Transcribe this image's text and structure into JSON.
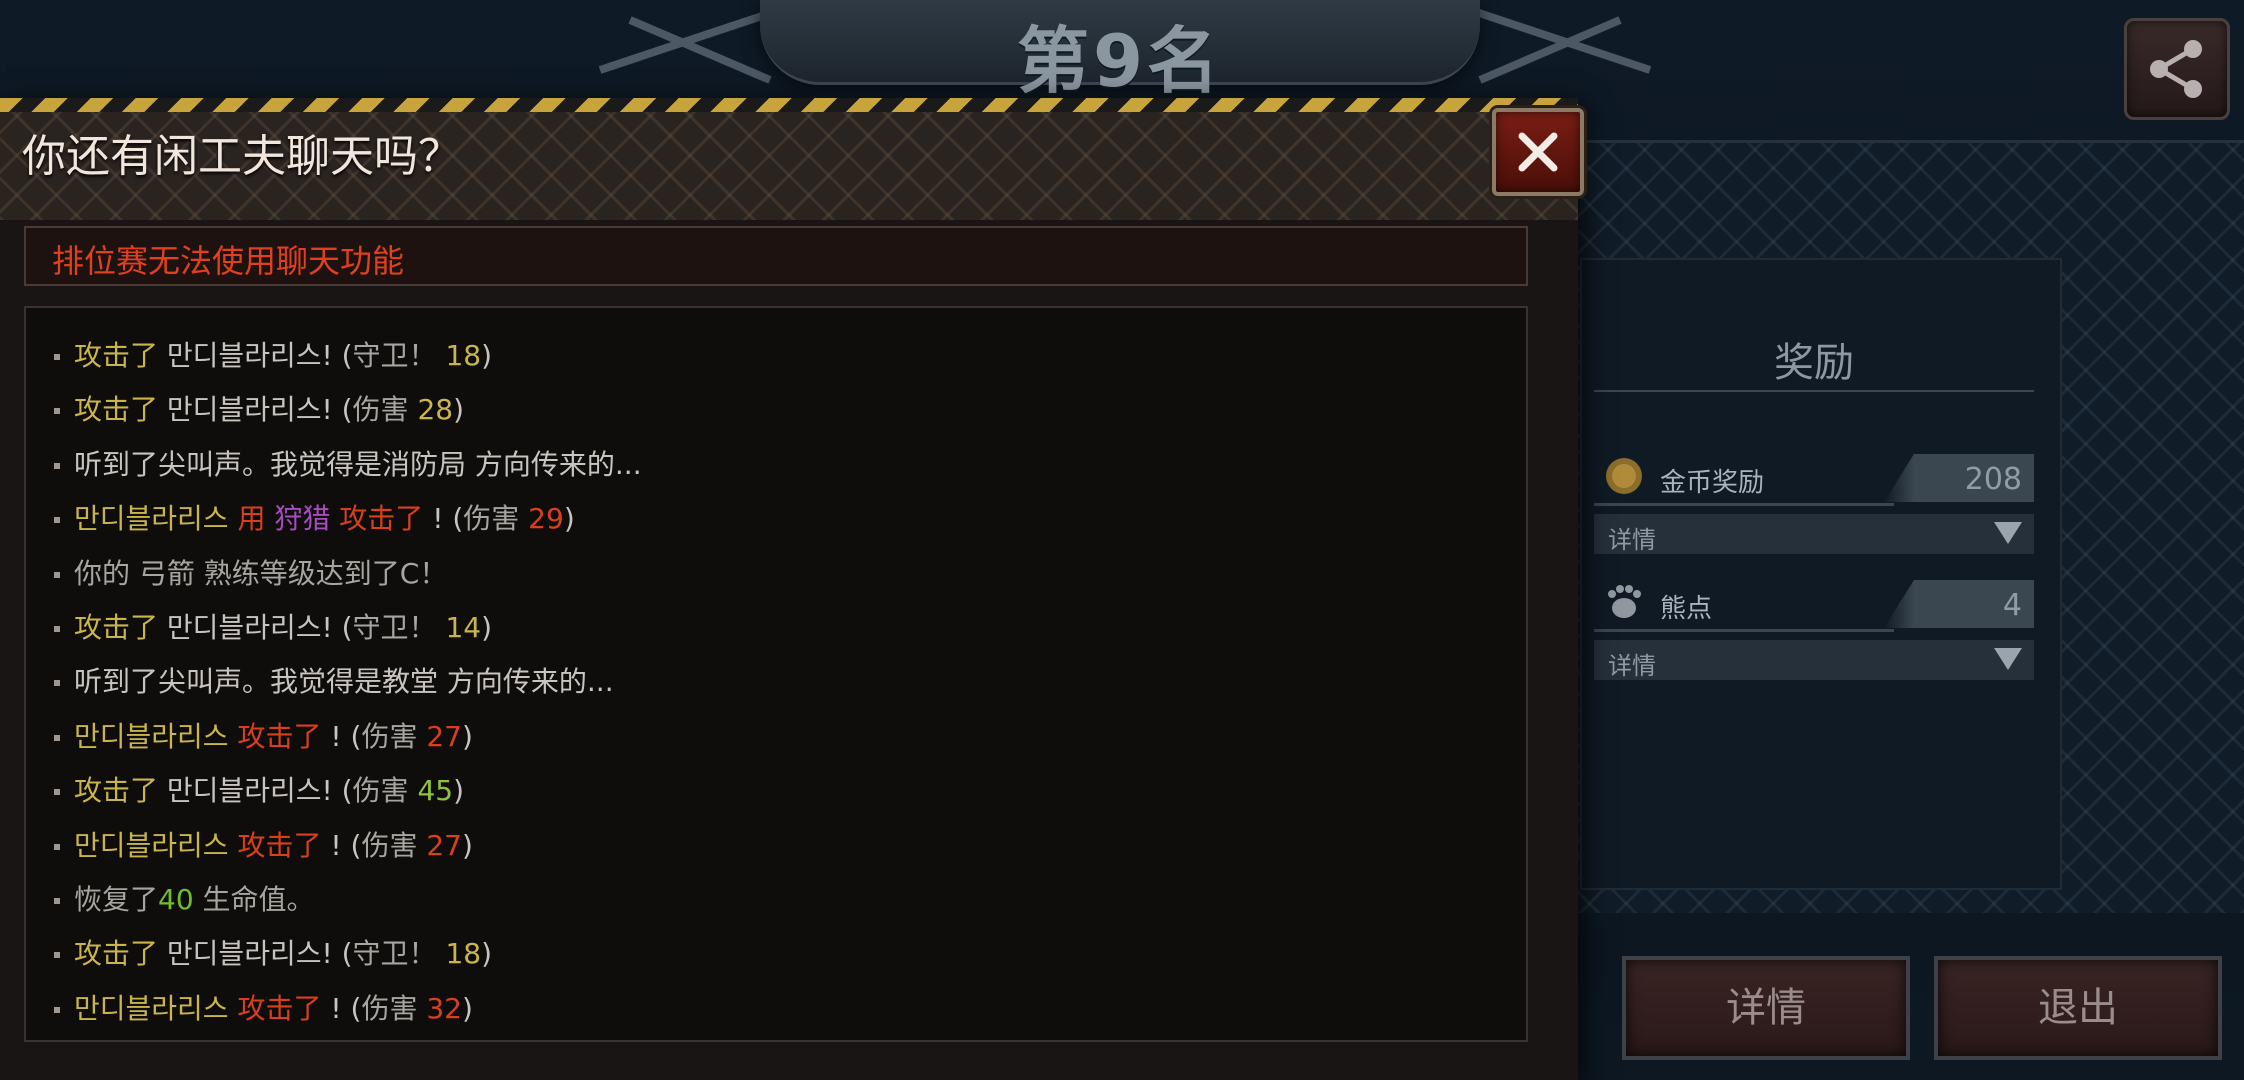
{
  "rank_title": "第9名",
  "share_icon": "share-icon",
  "reward": {
    "title": "奖励",
    "items": [
      {
        "icon": "gold-coin-icon",
        "label": "金币奖励",
        "value": "208",
        "detail": "详情"
      },
      {
        "icon": "bear-paw-icon",
        "label": "熊点",
        "value": "4",
        "detail": "详情"
      }
    ]
  },
  "buttons": {
    "detail": "详情",
    "exit": "退出"
  },
  "dialog": {
    "title": "你还有闲工夫聊天吗？",
    "notice": "排位赛无法使用聊天功能",
    "log": [
      [
        {
          "t": "攻击了",
          "c": "y"
        },
        {
          "t": " 만디블라리스! (",
          "c": "w"
        },
        {
          "t": "守卫！ ",
          "c": "g"
        },
        {
          "t": "18",
          "c": "y"
        },
        {
          "t": ")",
          "c": "w"
        }
      ],
      [
        {
          "t": "攻击了",
          "c": "y"
        },
        {
          "t": " 만디블라리스! (",
          "c": "w"
        },
        {
          "t": "伤害 ",
          "c": "g"
        },
        {
          "t": "28",
          "c": "y"
        },
        {
          "t": ")",
          "c": "w"
        }
      ],
      [
        {
          "t": "听到了尖叫声。我觉得是消防局 方向传来的...",
          "c": "w"
        }
      ],
      [
        {
          "t": "만디블라리스 ",
          "c": "y"
        },
        {
          "t": " 用 ",
          "c": "o"
        },
        {
          "t": "狩猎",
          "c": "p"
        },
        {
          "t": " 攻击了 ",
          "c": "o"
        },
        {
          "t": " ! (",
          "c": "w"
        },
        {
          "t": "伤害 ",
          "c": "g"
        },
        {
          "t": "29",
          "c": "o"
        },
        {
          "t": ")",
          "c": "w"
        }
      ],
      [
        {
          "t": "你的 弓箭 熟练等级达到了C！",
          "c": "g"
        }
      ],
      [
        {
          "t": "攻击了",
          "c": "y"
        },
        {
          "t": " 만디블라리스! (",
          "c": "w"
        },
        {
          "t": "守卫！ ",
          "c": "g"
        },
        {
          "t": "14",
          "c": "y"
        },
        {
          "t": ")",
          "c": "w"
        }
      ],
      [
        {
          "t": "听到了尖叫声。我觉得是教堂 方向传来的...",
          "c": "w"
        }
      ],
      [
        {
          "t": "만디블라리스 ",
          "c": "y"
        },
        {
          "t": " 攻击了",
          "c": "o"
        },
        {
          "t": " ! (",
          "c": "w"
        },
        {
          "t": "伤害 ",
          "c": "g"
        },
        {
          "t": "27",
          "c": "o"
        },
        {
          "t": ")",
          "c": "w"
        }
      ],
      [
        {
          "t": "攻击了",
          "c": "y"
        },
        {
          "t": " 만디블라리스! (",
          "c": "w"
        },
        {
          "t": "伤害 ",
          "c": "g"
        },
        {
          "t": "45",
          "c": "n"
        },
        {
          "t": ")",
          "c": "w"
        }
      ],
      [
        {
          "t": "만디블라리스 ",
          "c": "y"
        },
        {
          "t": " 攻击了",
          "c": "o"
        },
        {
          "t": " ! (",
          "c": "w"
        },
        {
          "t": "伤害 ",
          "c": "g"
        },
        {
          "t": "27",
          "c": "o"
        },
        {
          "t": ")",
          "c": "w"
        }
      ],
      [
        {
          "t": "恢复了",
          "c": "g"
        },
        {
          "t": "40",
          "c": "gr"
        },
        {
          "t": " 生命值。",
          "c": "g"
        }
      ],
      [
        {
          "t": "攻击了",
          "c": "y"
        },
        {
          "t": " 만디블라리스! (",
          "c": "w"
        },
        {
          "t": "守卫！ ",
          "c": "g"
        },
        {
          "t": "18",
          "c": "y"
        },
        {
          "t": ")",
          "c": "w"
        }
      ],
      [
        {
          "t": "만디블라리스 ",
          "c": "y"
        },
        {
          "t": " 攻击了",
          "c": "o"
        },
        {
          "t": " ! (",
          "c": "w"
        },
        {
          "t": "伤害 ",
          "c": "g"
        },
        {
          "t": "32",
          "c": "o"
        },
        {
          "t": ")",
          "c": "w"
        }
      ]
    ]
  }
}
